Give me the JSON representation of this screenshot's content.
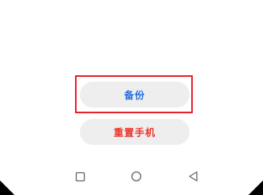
{
  "actions": {
    "backup_label": "备份",
    "reset_label": "重置手机"
  },
  "colors": {
    "backup_text": "#1f6fe0",
    "reset_text": "#e8362c",
    "highlight_border": "#e8212a",
    "button_bg": "#eeeeef"
  },
  "navbar": {
    "recent_icon": "square-icon",
    "home_icon": "circle-icon",
    "back_icon": "triangle-back-icon"
  }
}
